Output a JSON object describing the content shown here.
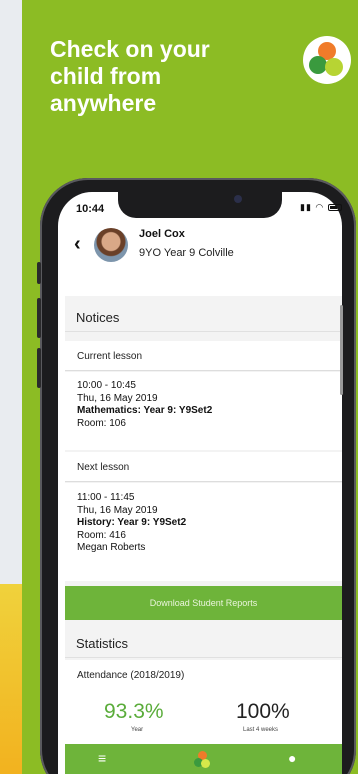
{
  "banner": {
    "headline": "Check on your\nchild from\nanywhere"
  },
  "status_bar": {
    "time": "10:44",
    "icons": [
      "signal-icon",
      "wifi-icon",
      "battery-icon"
    ]
  },
  "student": {
    "name": "Joel Cox",
    "meta": "9YO  Year 9  Colville"
  },
  "notices": {
    "title": "Notices",
    "current_label": "Current lesson",
    "current": {
      "time": "10:00 - 10:45",
      "date": "Thu, 16 May 2019",
      "subject": "Mathematics: Year 9: Y9Set2",
      "room": "Room: 106"
    },
    "next_label": "Next lesson",
    "next": {
      "time": "11:00 - 11:45",
      "date": "Thu, 16 May 2019",
      "subject": "History: Year 9: Y9Set2",
      "room": "Room: 416",
      "teacher": "Megan Roberts"
    }
  },
  "actions": {
    "download_reports": "Download Student Reports"
  },
  "statistics": {
    "title": "Statistics",
    "attendance_title": "Attendance (2018/2019)",
    "year_value": "93.3%",
    "year_caption": "Year",
    "recent_value": "100%",
    "recent_caption": "Last 4 weeks"
  },
  "bottom_nav": {
    "items": [
      "menu-icon",
      "app-logo-icon",
      "profile-icon"
    ]
  },
  "colors": {
    "brand_green": "#8cbc24",
    "button_green": "#6eb43a",
    "stat_green": "#5aac3a"
  }
}
